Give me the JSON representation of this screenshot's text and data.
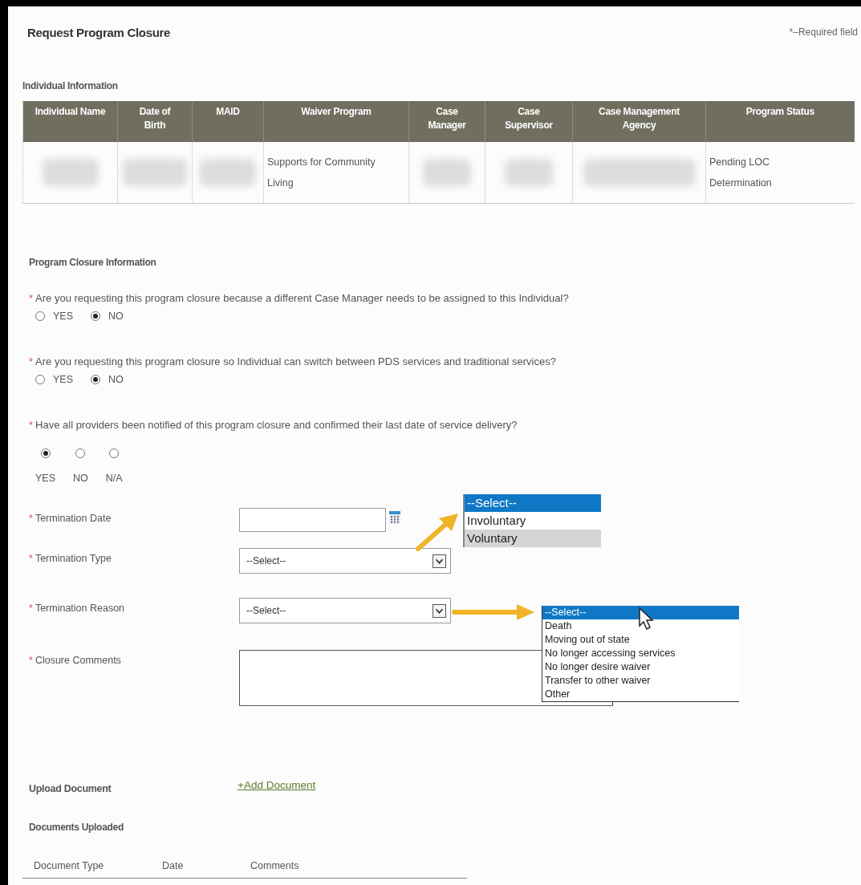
{
  "title": "Request Program Closure",
  "required_note": "*–Required field",
  "individual_information": {
    "heading": "Individual Information",
    "columns": [
      "Individual Name",
      "Date of Birth",
      "MAID",
      "Waiver Program",
      "Case Manager",
      "Case Supervisor",
      "Case Management Agency",
      "Program Status"
    ],
    "rows": [
      {
        "cells": [
          {
            "redacted": true
          },
          {
            "redacted": true
          },
          {
            "redacted": true
          },
          {
            "redacted": false,
            "text": "Supports for Community Living"
          },
          {
            "redacted": true
          },
          {
            "redacted": true
          },
          {
            "redacted": true
          },
          {
            "redacted": false,
            "text": "Pending LOC Determination"
          }
        ]
      }
    ]
  },
  "closure_information": {
    "heading": "Program Closure Information",
    "questions": [
      {
        "marker": "*",
        "text": "Are you requesting this program closure because a different Case Manager needs to be assigned to this Individual?",
        "kind": "inline",
        "options": [
          {
            "label": "YES",
            "selected": false
          },
          {
            "label": "NO",
            "selected": true
          }
        ]
      },
      {
        "marker": "*",
        "text": "Are you requesting this program closure so Individual can switch between PDS services and traditional services?",
        "kind": "inline",
        "options": [
          {
            "label": "YES",
            "selected": false
          },
          {
            "label": "NO",
            "selected": true
          }
        ]
      },
      {
        "marker": "*",
        "text": "Have all providers been notified of this program closure and confirmed their last date of service delivery?",
        "kind": "stacked",
        "options": [
          {
            "label": "YES",
            "selected": true
          },
          {
            "label": "NO",
            "selected": false
          },
          {
            "label": "N/A",
            "selected": false
          }
        ]
      }
    ],
    "fields": [
      {
        "kind": "date",
        "marker": "*",
        "label": "Termination Date"
      },
      {
        "kind": "select",
        "marker": "*",
        "label": "Termination Type",
        "value": "--Select--",
        "open_list": {
          "options": [
            {
              "label": "--Select--",
              "selected": true,
              "highlighted": false
            },
            {
              "label": "Involuntary",
              "selected": false,
              "highlighted": false
            },
            {
              "label": "Voluntary",
              "selected": false,
              "highlighted": true
            }
          ]
        }
      },
      {
        "kind": "select",
        "marker": "*",
        "label": "Termination Reason",
        "value": "--Select--",
        "open_list": {
          "options": [
            {
              "label": "--Select--",
              "selected": true,
              "highlighted": false
            },
            {
              "label": "Death",
              "selected": false,
              "highlighted": false
            },
            {
              "label": "Moving out of state",
              "selected": false,
              "highlighted": false
            },
            {
              "label": "No longer accessing services",
              "selected": false,
              "highlighted": false
            },
            {
              "label": "No longer desire waiver",
              "selected": false,
              "highlighted": false
            },
            {
              "label": "Transfer to other waiver",
              "selected": false,
              "highlighted": false
            },
            {
              "label": "Other",
              "selected": false,
              "highlighted": false
            }
          ]
        }
      },
      {
        "kind": "textarea",
        "marker": "*",
        "label": "Closure Comments"
      }
    ]
  },
  "upload": {
    "label": "Upload Document",
    "link": "+Add Document"
  },
  "documents_uploaded": {
    "heading": "Documents Uploaded",
    "columns": [
      "Document Type",
      "Date",
      "Comments"
    ]
  }
}
